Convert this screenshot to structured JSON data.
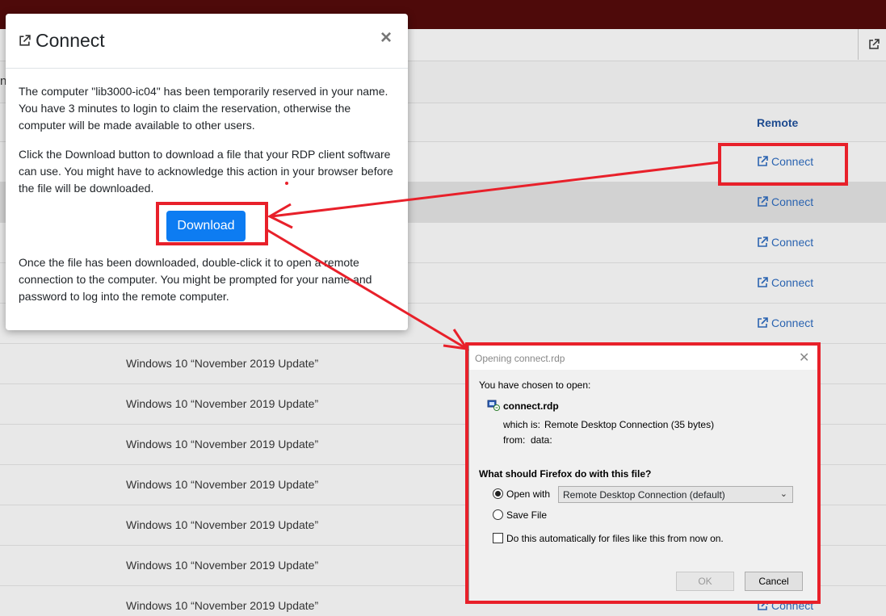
{
  "background": {
    "remote_header": "Remote",
    "connect_label": "Connect",
    "os_label": "Windows 10 “November 2019 Update”",
    "subhead_letter": "n"
  },
  "modal": {
    "title": "Connect",
    "close": "×",
    "para1": "The computer \"lib3000-ic04\" has been temporarily reserved in your name. You have 3 minutes to login to claim the reservation, otherwise the computer will be made available to other users.",
    "para2": "Click the Download button to download a file that your RDP client software can use. You might have to acknowledge this action in your browser before the file will be downloaded.",
    "download_label": "Download",
    "para3": "Once the file has been downloaded, double-click it to open a remote connection to the computer. You might be prompted for your name and password to log into the remote computer."
  },
  "firefox_dialog": {
    "title": "Opening connect.rdp",
    "close": "✕",
    "chosen": "You have chosen to open:",
    "filename": "connect.rdp",
    "which_is_label": "which is:",
    "which_is_value": "Remote Desktop Connection (35 bytes)",
    "from_label": "from:",
    "from_value": "data:",
    "question": "What should Firefox do with this file?",
    "open_with": "Open with",
    "open_with_selected": true,
    "app_select": "Remote Desktop Connection (default)",
    "save_file": "Save File",
    "auto": "Do this automatically for files like this from now on.",
    "ok": "OK",
    "cancel": "Cancel"
  },
  "colors": {
    "annotation": "#e8202a",
    "link": "#2a63b0",
    "button": "#0d7cf2",
    "topbar": "#4e0a0a"
  }
}
